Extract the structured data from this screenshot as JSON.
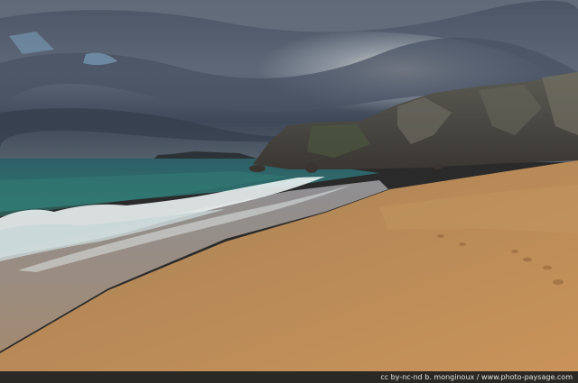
{
  "photo": {
    "subject": "sandy beach with breaking waves and rocky cliff under cloudy sky",
    "colors": {
      "sky_dark": "#3d4656",
      "sky_light": "#c9cfd4",
      "sea": "#2f6f6a",
      "foam": "#e9efee",
      "sand": "#b98a55",
      "cliff": "#4a4a44"
    }
  },
  "credit": {
    "text": "cc by-nc-nd    b. monginoux / www.photo-paysage.com"
  }
}
